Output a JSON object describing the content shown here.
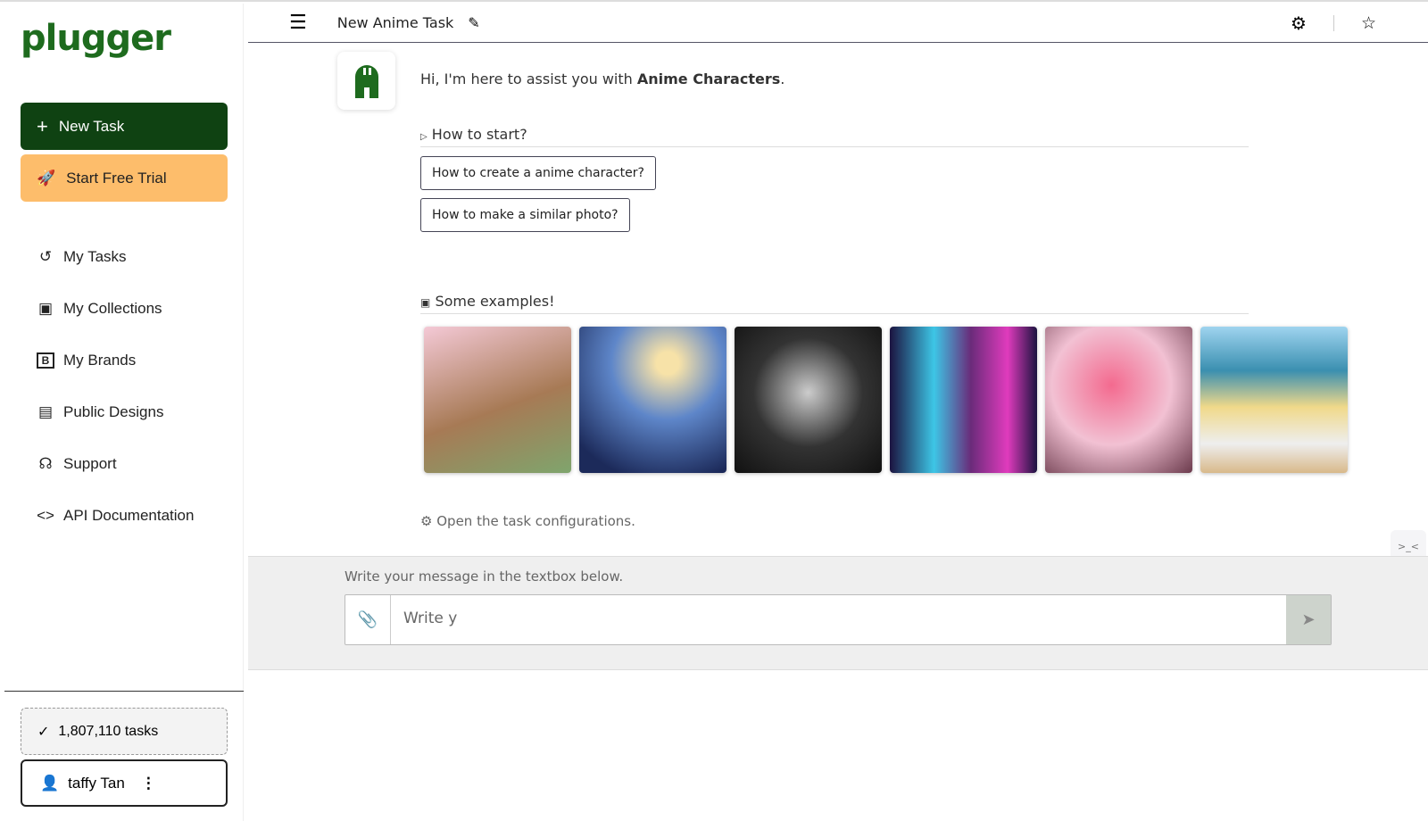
{
  "brand": {
    "logo": "plugger",
    "primary": "#0f4212",
    "accent": "#fdbd6b"
  },
  "sidebar": {
    "new_task": "New Task",
    "trial": "Start Free Trial",
    "items": [
      {
        "label": "My Tasks",
        "icon": "history-icon"
      },
      {
        "label": "My Collections",
        "icon": "collections-icon"
      },
      {
        "label": "My Brands",
        "icon": "brand-icon"
      },
      {
        "label": "Public Designs",
        "icon": "layout-icon"
      },
      {
        "label": "Support",
        "icon": "headset-icon"
      },
      {
        "label": "API Documentation",
        "icon": "code-icon"
      }
    ],
    "task_count": "1,807,110 tasks",
    "user": "taffy Tan"
  },
  "header": {
    "title": "New Anime Task"
  },
  "main": {
    "greeting_prefix": "Hi, I'm here to assist you with ",
    "greeting_bold": "Anime Characters",
    "greeting_suffix": ".",
    "how_to_start": "How to start?",
    "questions": [
      "How to create a anime character?",
      "How to make a similar photo?"
    ],
    "examples_title": "Some examples!",
    "config_link": "Open the task configurations."
  },
  "composer": {
    "hint": "Write your message in the textbox below.",
    "value": "Write y"
  }
}
